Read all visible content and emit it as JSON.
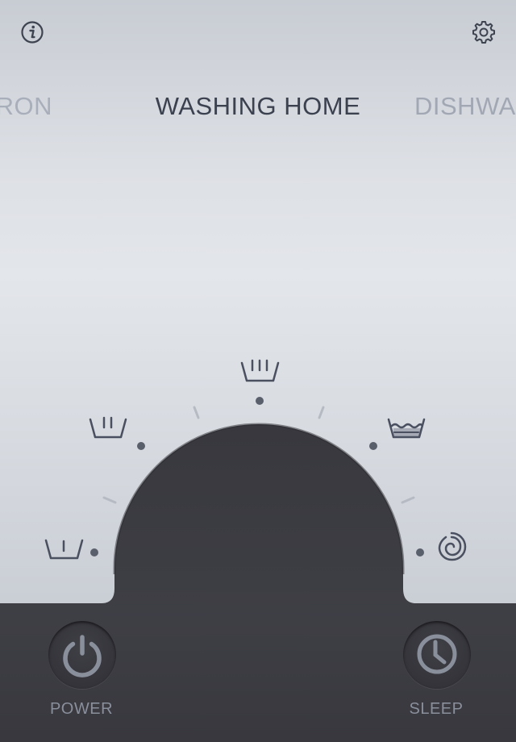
{
  "header": {
    "info_icon": "info-icon",
    "settings_icon": "gear-icon"
  },
  "carousel": {
    "prev_label": "IRON",
    "current_label": "WASHING HOME",
    "next_label": "DISHWASHER"
  },
  "dial": {
    "settings": [
      {
        "name": "wash-temp-1-icon"
      },
      {
        "name": "wash-temp-2-icon"
      },
      {
        "name": "wash-temp-3-icon"
      },
      {
        "name": "hand-wash-icon"
      },
      {
        "name": "spin-icon"
      }
    ]
  },
  "controls": {
    "power_label": "POWER",
    "sleep_label": "SLEEP"
  },
  "colors": {
    "panel_light": "#e1e4e8",
    "panel_dark": "#3a3a40",
    "icon": "#4a5060",
    "button_icon": "#8a8f9c"
  }
}
